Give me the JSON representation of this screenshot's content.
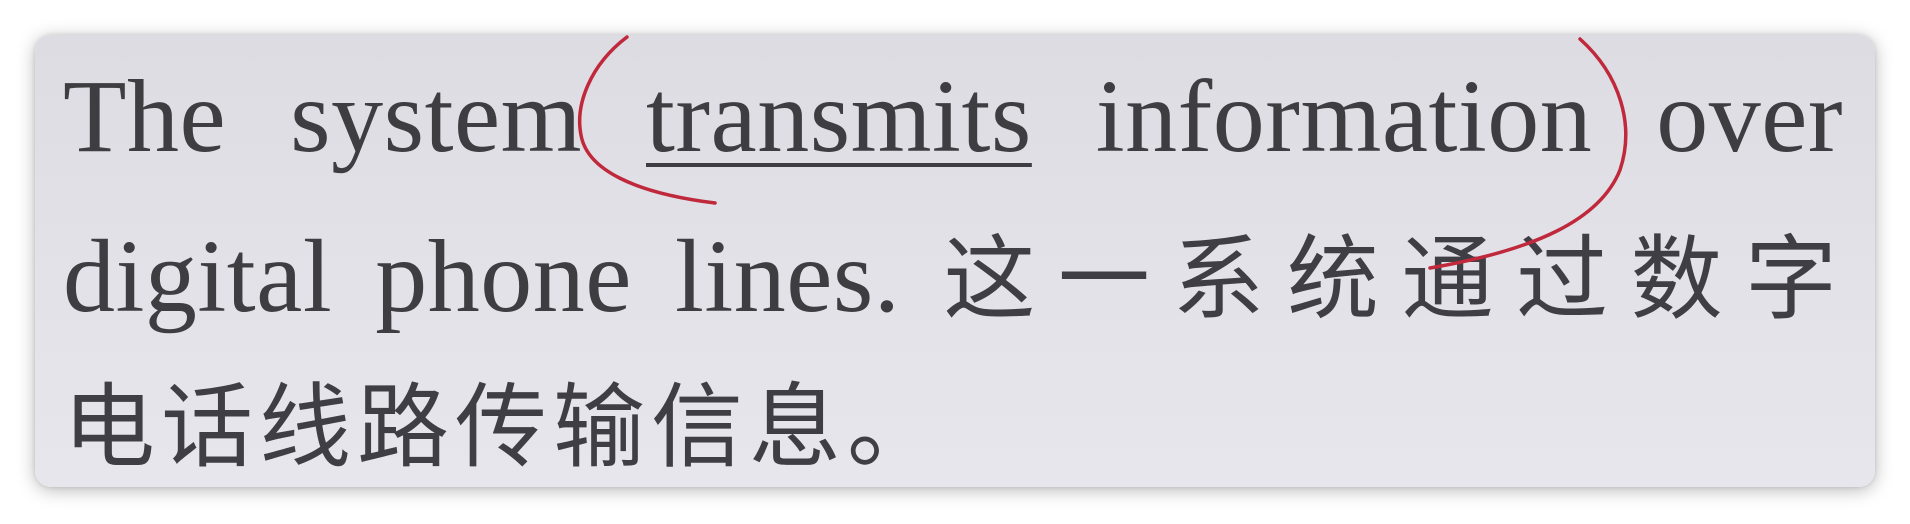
{
  "text": {
    "line1": {
      "w1": "The",
      "w2": "system",
      "w3": "transmits",
      "w4": "information",
      "w5": "over"
    },
    "line2": {
      "w1": "digital",
      "w2": "phone",
      "w3": "lines.",
      "zh": "这一系统通过数字"
    },
    "line3": {
      "zh": "电话线路传输信息。"
    }
  },
  "annotation": {
    "color": "#c0283c",
    "underline_color": "#3d3d42"
  }
}
